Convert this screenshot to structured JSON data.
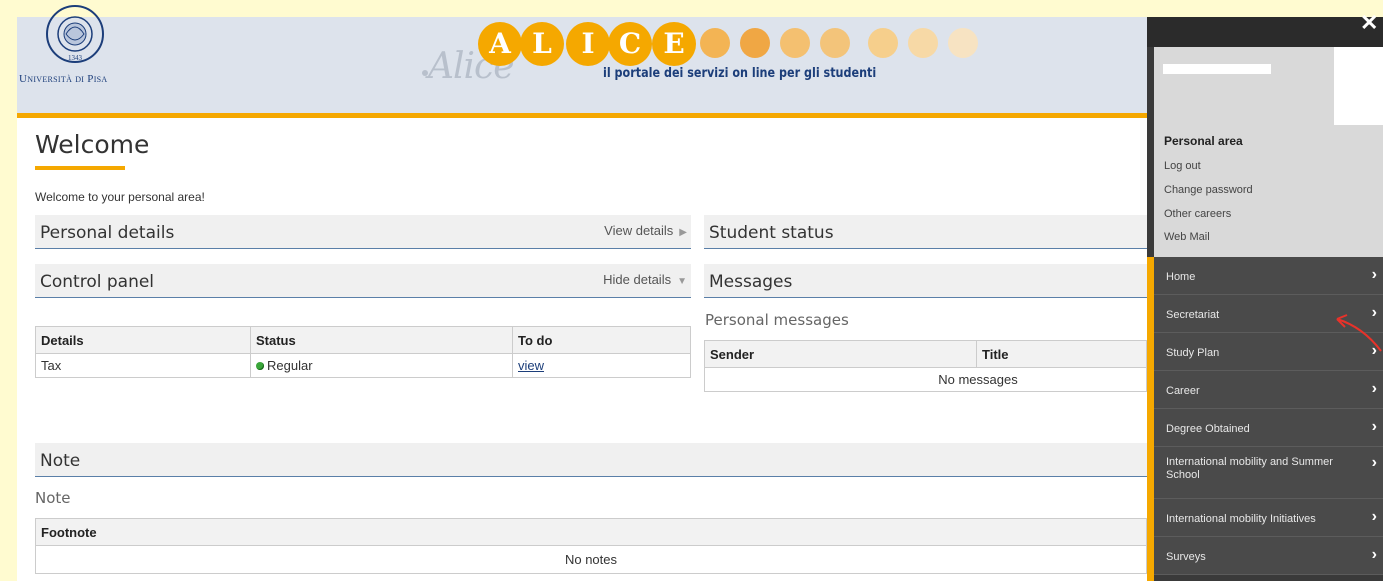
{
  "header": {
    "university": "Università di Pisa",
    "brand_letters": [
      "A",
      "L",
      "I",
      "C",
      "E"
    ],
    "tagline": "il portale dei servizi on line per gli studenti",
    "accent": "#f5a800"
  },
  "welcome": {
    "title": "Welcome",
    "subtitle": "Welcome to your personal area!"
  },
  "personal_details": {
    "title": "Personal details",
    "link": "View details"
  },
  "student_status": {
    "title": "Student status"
  },
  "control_panel": {
    "title": "Control panel",
    "link": "Hide details",
    "columns": [
      "Details",
      "Status",
      "To do"
    ],
    "rows": [
      {
        "details": "Tax",
        "status": "Regular",
        "todo": "view"
      }
    ]
  },
  "messages": {
    "title": "Messages",
    "subtitle": "Personal messages",
    "columns": [
      "Sender",
      "Title"
    ],
    "empty": "No messages"
  },
  "note": {
    "title": "Note",
    "subtitle": "Note",
    "columns": [
      "Footnote"
    ],
    "empty": "No notes"
  },
  "sidebar": {
    "close": "✕",
    "section_title": "Personal area",
    "links": [
      "Log out",
      "Change password",
      "Other careers",
      "Web Mail"
    ],
    "nav": [
      "Home",
      "Secretariat",
      "Study Plan",
      "Career",
      "Degree Obtained",
      "International mobility and Summer School",
      "International mobility Initiatives",
      "Surveys"
    ],
    "chevron": "›"
  }
}
